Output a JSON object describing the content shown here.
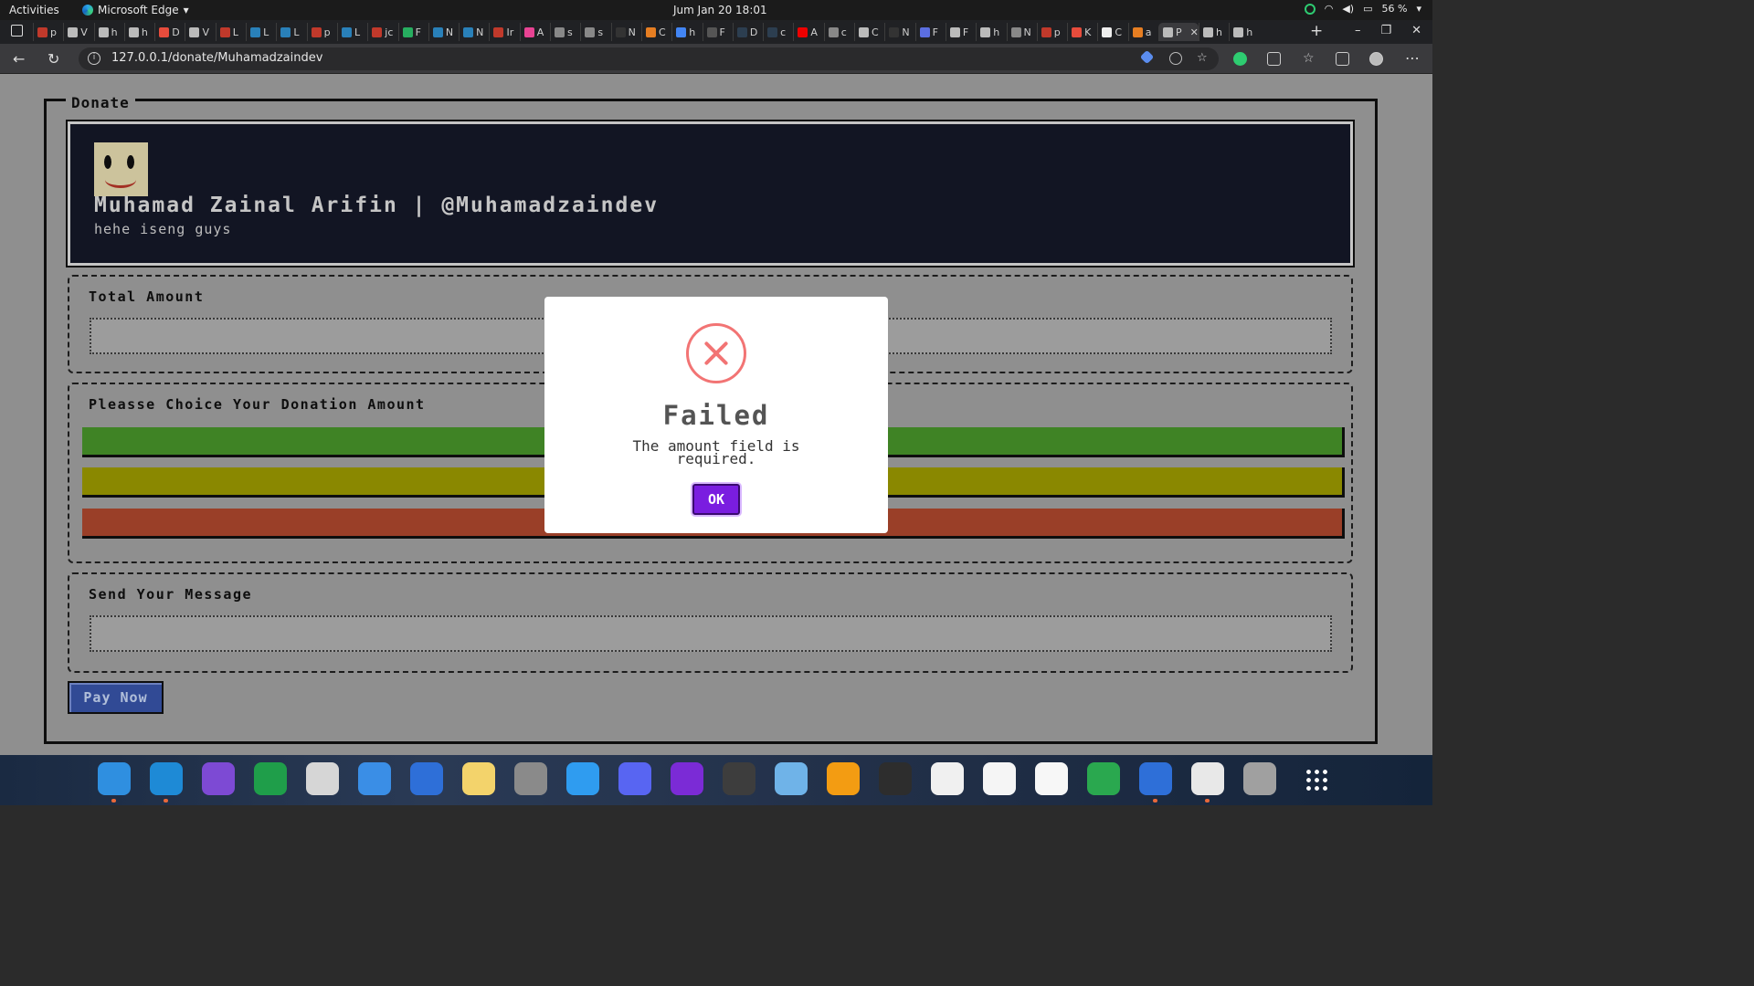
{
  "system": {
    "activities": "Activities",
    "app_name": "Microsoft Edge",
    "clock": "Jum Jan 20  18:01",
    "battery": "56 %"
  },
  "browser": {
    "url": "127.0.0.1/donate/Muhamadzaindev",
    "tabs": [
      {
        "label": "p",
        "color": "#c0392b"
      },
      {
        "label": "V",
        "color": "#bbb"
      },
      {
        "label": "h",
        "color": "#bbb"
      },
      {
        "label": "h",
        "color": "#bbb"
      },
      {
        "label": "D",
        "color": "#e74c3c"
      },
      {
        "label": "V",
        "color": "#bbb"
      },
      {
        "label": "L",
        "color": "#c0392b"
      },
      {
        "label": "L",
        "color": "#2980b9"
      },
      {
        "label": "L",
        "color": "#2980b9"
      },
      {
        "label": "p",
        "color": "#c0392b"
      },
      {
        "label": "L",
        "color": "#2980b9"
      },
      {
        "label": "jc",
        "color": "#c0392b"
      },
      {
        "label": "F",
        "color": "#27ae60"
      },
      {
        "label": "N",
        "color": "#2980b9"
      },
      {
        "label": "N",
        "color": "#2980b9"
      },
      {
        "label": "Ir",
        "color": "#c0392b"
      },
      {
        "label": "A",
        "color": "#e84393"
      },
      {
        "label": "s",
        "color": "#888"
      },
      {
        "label": "s",
        "color": "#888"
      },
      {
        "label": "N",
        "color": "#333"
      },
      {
        "label": "C",
        "color": "#e67e22"
      },
      {
        "label": "h",
        "color": "#4285f4"
      },
      {
        "label": "F",
        "color": "#555"
      },
      {
        "label": "D",
        "color": "#2c3e50"
      },
      {
        "label": "c",
        "color": "#2c3e50"
      },
      {
        "label": "A",
        "color": "#e00"
      },
      {
        "label": "c",
        "color": "#888"
      },
      {
        "label": "C",
        "color": "#bbb"
      },
      {
        "label": "N",
        "color": "#333"
      },
      {
        "label": "F",
        "color": "#5b6ee1"
      },
      {
        "label": "F",
        "color": "#bbb"
      },
      {
        "label": "h",
        "color": "#bbb"
      },
      {
        "label": "N",
        "color": "#888"
      },
      {
        "label": "p",
        "color": "#c0392b"
      },
      {
        "label": "K",
        "color": "#e74c3c"
      },
      {
        "label": "C",
        "color": "#eee"
      },
      {
        "label": "a",
        "color": "#e67e22"
      },
      {
        "label": "P",
        "color": "#bbb"
      },
      {
        "label": "h",
        "color": "#bbb"
      },
      {
        "label": "h",
        "color": "#bbb"
      }
    ]
  },
  "page": {
    "legend": "Donate",
    "profile": {
      "name": "Muhamad Zainal Arifin | @Muhamadzaindev",
      "bio": "hehe iseng guys"
    },
    "total_amount": {
      "label": "Total Amount",
      "value": ""
    },
    "choice": {
      "label": "Pleasse Choice Your Donation Amount",
      "options": [
        {
          "color": "#4a9a2c"
        },
        {
          "color": "#a3a000"
        },
        {
          "color": "#b54a30"
        }
      ]
    },
    "message": {
      "label": "Send Your Message",
      "value": ""
    },
    "pay_button": "Pay Now"
  },
  "modal": {
    "title": "Failed",
    "message": "The amount field is required.",
    "ok": "OK",
    "icon": "error-x-icon",
    "icon_color": "#f27474",
    "ok_color": "#7a1de0"
  },
  "dock": {
    "apps": [
      {
        "name": "vscode-icon",
        "color": "#2f8fe0"
      },
      {
        "name": "edge-icon",
        "color": "#1e8ad6"
      },
      {
        "name": "tor-browser-icon",
        "color": "#7d4ad4"
      },
      {
        "name": "chat-icon",
        "color": "#1f9e4a"
      },
      {
        "name": "gimp-icon",
        "color": "#d6d6d6"
      },
      {
        "name": "finder-icon",
        "color": "#3a8ee6"
      },
      {
        "name": "hexagon-app-icon",
        "color": "#2e6fd8"
      },
      {
        "name": "notes-icon",
        "color": "#f3d36b"
      },
      {
        "name": "settings-icon",
        "color": "#8a8a8a"
      },
      {
        "name": "appstore-icon",
        "color": "#2f9cf0"
      },
      {
        "name": "discord-icon",
        "color": "#5865f2"
      },
      {
        "name": "launcher-icon",
        "color": "#7b2bd6"
      },
      {
        "name": "screenshot-icon",
        "color": "#3d3d3d"
      },
      {
        "name": "files-icon",
        "color": "#6fb3e8"
      },
      {
        "name": "vlc-icon",
        "color": "#f39c12"
      },
      {
        "name": "terminal-icon",
        "color": "#2d2d2d"
      },
      {
        "name": "presentation-icon",
        "color": "#f0f0f0"
      },
      {
        "name": "spreadsheet-icon",
        "color": "#f5f5f5"
      },
      {
        "name": "text-editor-icon",
        "color": "#f7f7f7"
      },
      {
        "name": "drawing-icon",
        "color": "#2aa84f"
      },
      {
        "name": "hexagon-app-2-icon",
        "color": "#2e6fd8"
      },
      {
        "name": "camera-icon",
        "color": "#e8e8e8"
      },
      {
        "name": "disk-icon",
        "color": "#a0a0a0"
      }
    ]
  }
}
